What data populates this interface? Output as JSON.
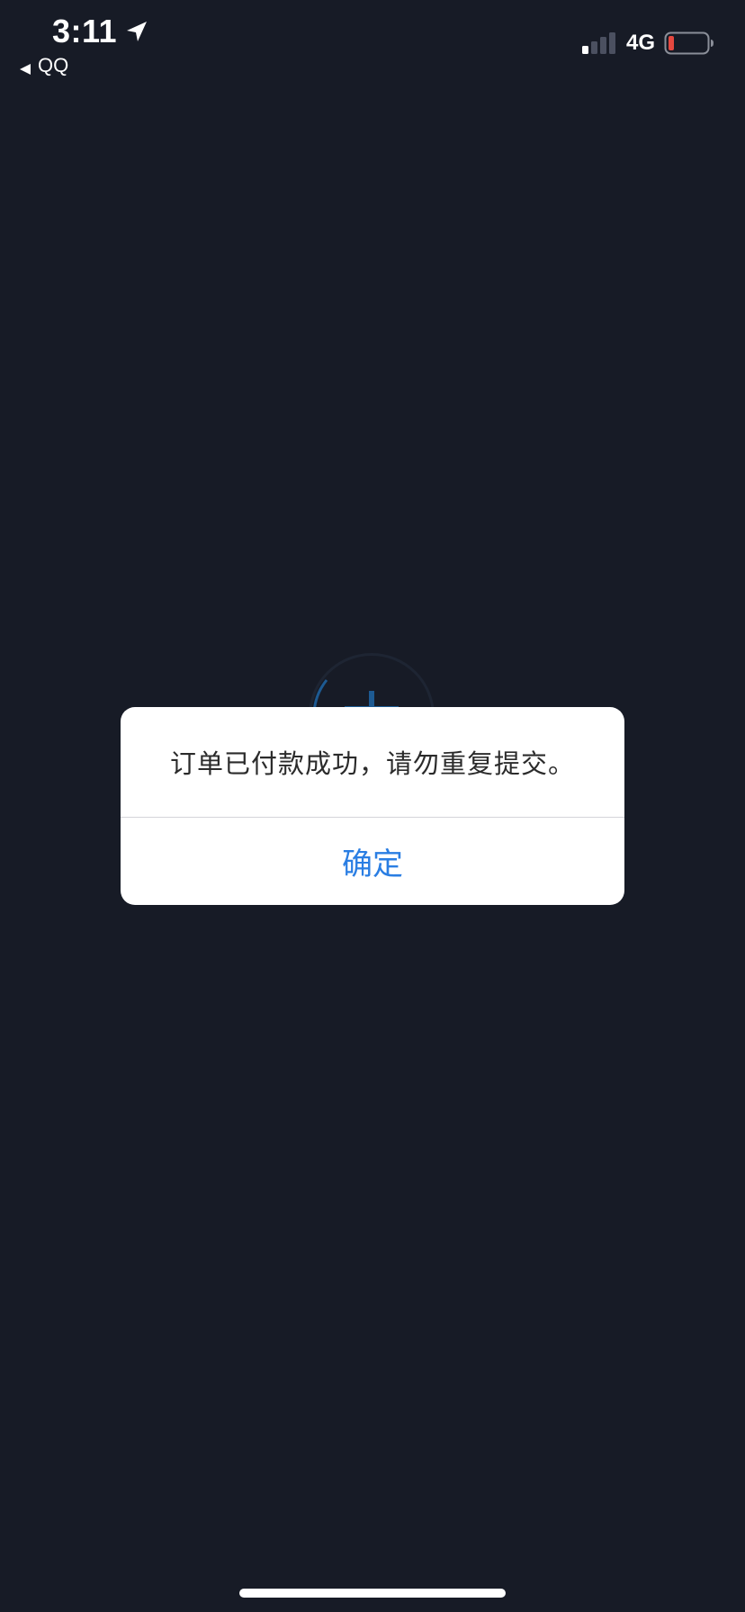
{
  "status_bar": {
    "time": "3:11",
    "back_app_label": "QQ",
    "network": "4G",
    "battery_color": "#e5483f",
    "icons": [
      "location-arrow-icon",
      "back-arrow-icon",
      "signal-bars-icon",
      "battery-icon"
    ]
  },
  "alert": {
    "message": "订单已付款成功，请勿重复提交。",
    "confirm_label": "确定",
    "confirm_color": "#2a7ee3"
  },
  "colors": {
    "background": "#171b26",
    "dialog_background": "#ffffff"
  }
}
